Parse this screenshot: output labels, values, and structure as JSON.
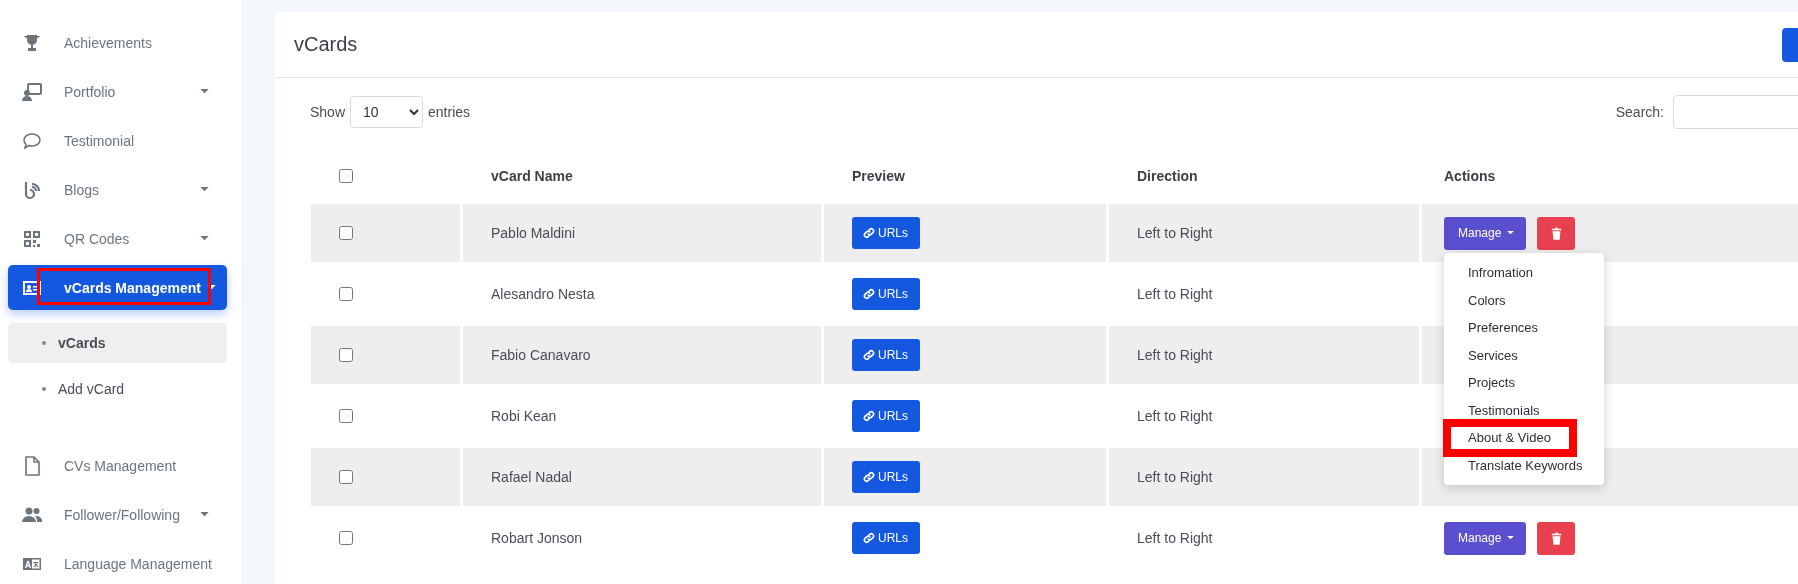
{
  "sidebar": {
    "items": [
      {
        "label": "Achievements",
        "has_submenu": false,
        "selected": false,
        "highlighted": false
      },
      {
        "label": "Portfolio",
        "has_submenu": true,
        "selected": false,
        "highlighted": false
      },
      {
        "label": "Testimonial",
        "has_submenu": false,
        "selected": false,
        "highlighted": false
      },
      {
        "label": "Blogs",
        "has_submenu": true,
        "selected": false,
        "highlighted": false
      },
      {
        "label": "QR Codes",
        "has_submenu": true,
        "selected": false,
        "highlighted": false
      },
      {
        "label": "vCards Management",
        "has_submenu": true,
        "selected": true,
        "highlighted": true,
        "children": [
          {
            "label": "vCards",
            "selected": true
          },
          {
            "label": "Add vCard",
            "selected": false
          }
        ]
      },
      {
        "label": "CVs Management",
        "has_submenu": false,
        "selected": false,
        "highlighted": false
      },
      {
        "label": "Follower/Following",
        "has_submenu": true,
        "selected": false,
        "highlighted": false
      },
      {
        "label": "Language Management",
        "has_submenu": false,
        "selected": false,
        "highlighted": false
      }
    ]
  },
  "card": {
    "title": "vCards",
    "length": {
      "show": "Show",
      "value": "10",
      "suffix": "entries"
    },
    "search": {
      "label": "Search:"
    },
    "table": {
      "select_all": {
        "checked": false
      },
      "columns": [
        "vCard Name",
        "Preview",
        "Direction",
        "Actions"
      ],
      "rows": [
        {
          "checked": false,
          "name": "Pablo Maldini",
          "preview": "URLs",
          "direction": "Left to Right",
          "actions": {
            "manage": "Manage",
            "menu": [
              {
                "label": "Infromation",
                "highlighted": false
              },
              {
                "label": "Colors",
                "highlighted": false
              },
              {
                "label": "Preferences",
                "highlighted": false
              },
              {
                "label": "Services",
                "highlighted": false
              },
              {
                "label": "Projects",
                "highlighted": false
              },
              {
                "label": "Testimonials",
                "highlighted": false
              },
              {
                "label": "About & Video",
                "highlighted": true
              },
              {
                "label": "Translate Keywords",
                "highlighted": false
              }
            ]
          }
        },
        {
          "checked": false,
          "name": "Alesandro Nesta",
          "preview": "URLs",
          "direction": "Left to Right"
        },
        {
          "checked": false,
          "name": "Fabio Canavaro",
          "preview": "URLs",
          "direction": "Left to Right"
        },
        {
          "checked": false,
          "name": "Robi Kean",
          "preview": "URLs",
          "direction": "Left to Right"
        },
        {
          "checked": false,
          "name": "Rafael Nadal",
          "preview": "URLs",
          "direction": "Left to Right"
        },
        {
          "checked": false,
          "name": "Robart Jonson",
          "preview": "URLs",
          "direction": "Left to Right",
          "actions": {
            "manage": "Manage"
          }
        }
      ]
    }
  }
}
